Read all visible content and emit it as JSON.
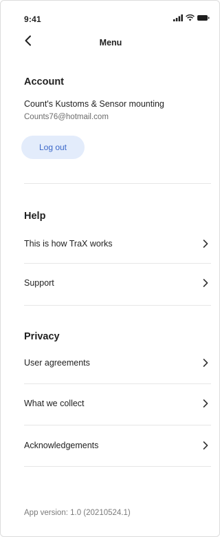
{
  "status_bar": {
    "time": "9:41"
  },
  "nav": {
    "title": "Menu",
    "back_icon": "chevron-left-icon"
  },
  "account": {
    "heading": "Account",
    "name": "Count's Kustoms & Sensor mounting",
    "email": "Counts76@hotmail.com",
    "logout_label": "Log out",
    "logout_bg": "#e3ecfb",
    "logout_color": "#3a66c8"
  },
  "help": {
    "heading": "Help",
    "items": [
      {
        "label": "This is how TraX works"
      },
      {
        "label": "Support"
      }
    ]
  },
  "privacy": {
    "heading": "Privacy",
    "items": [
      {
        "label": "User agreements"
      },
      {
        "label": "What we collect"
      },
      {
        "label": "Acknowledgements"
      }
    ]
  },
  "footer": {
    "app_version": "App version: 1.0 (20210524.1)"
  }
}
